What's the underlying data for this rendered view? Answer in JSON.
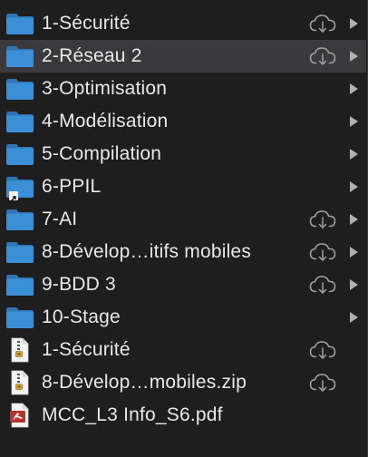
{
  "items": [
    {
      "label": "1-Sécurité",
      "kind": "folder",
      "cloud": true,
      "chevron": true,
      "selected": false
    },
    {
      "label": "2-Réseau 2",
      "kind": "folder",
      "cloud": true,
      "chevron": true,
      "selected": true
    },
    {
      "label": "3-Optimisation",
      "kind": "folder",
      "cloud": false,
      "chevron": true,
      "selected": false
    },
    {
      "label": "4-Modélisation",
      "kind": "folder",
      "cloud": false,
      "chevron": true,
      "selected": false
    },
    {
      "label": "5-Compilation",
      "kind": "folder",
      "cloud": false,
      "chevron": true,
      "selected": false
    },
    {
      "label": "6-PPIL",
      "kind": "folder-alias",
      "cloud": false,
      "chevron": true,
      "selected": false
    },
    {
      "label": "7-AI",
      "kind": "folder",
      "cloud": true,
      "chevron": true,
      "selected": false
    },
    {
      "label": "8-Dévelop…itifs mobiles",
      "kind": "folder",
      "cloud": true,
      "chevron": true,
      "selected": false
    },
    {
      "label": "9-BDD 3",
      "kind": "folder",
      "cloud": true,
      "chevron": true,
      "selected": false
    },
    {
      "label": "10-Stage",
      "kind": "folder",
      "cloud": false,
      "chevron": true,
      "selected": false
    },
    {
      "label": "1-Sécurité",
      "kind": "zip",
      "cloud": true,
      "chevron": false,
      "selected": false
    },
    {
      "label": "8-Dévelop…mobiles.zip",
      "kind": "zip",
      "cloud": true,
      "chevron": false,
      "selected": false
    },
    {
      "label": "MCC_L3 Info_S6.pdf",
      "kind": "pdf",
      "cloud": false,
      "chevron": false,
      "selected": false
    }
  ],
  "colors": {
    "background": "#1e1e1e",
    "selected_row": "#3a3a3c",
    "folder_body": "#3b8fd6",
    "folder_tab": "#2f74b3",
    "text": "#e8e8e8",
    "cloud": "#a0a0a0",
    "chevron": "#b0b0b0",
    "pdf_badge": "#b5312a"
  },
  "icons": {
    "folder": "folder-icon",
    "folder-alias": "folder-alias-icon",
    "zip": "zip-archive-icon",
    "pdf": "pdf-document-icon",
    "cloud": "cloud-download-icon",
    "chevron": "chevron-right-icon"
  }
}
